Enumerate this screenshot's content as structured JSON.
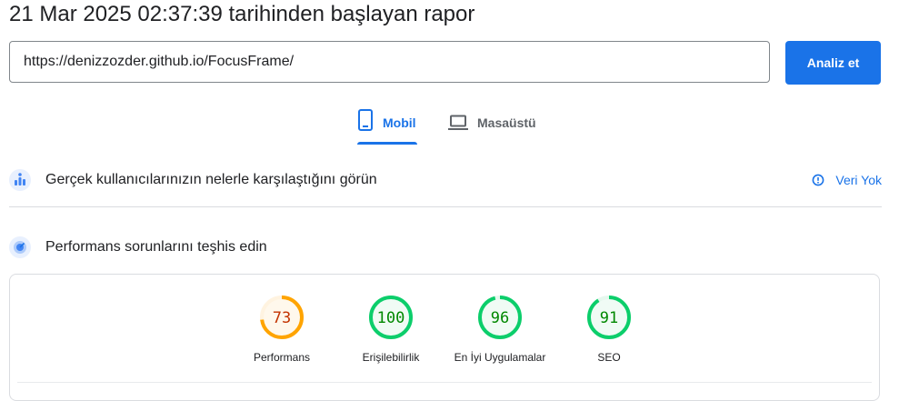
{
  "header": {
    "title": "21 Mar 2025 02:37:39 tarihinden başlayan rapor"
  },
  "search": {
    "value": "https://denizzozder.github.io/FocusFrame/",
    "button_label": "Analiz et"
  },
  "tabs": [
    {
      "label": "Mobil",
      "icon": "smartphone-icon",
      "active": true
    },
    {
      "label": "Masaüstü",
      "icon": "desktop-icon",
      "active": false
    }
  ],
  "field_data": {
    "title": "Gerçek kullanıcılarınızın nelerle karşılaştığını görün",
    "status_label": "Veri Yok",
    "icon": "users-chart-icon",
    "status_icon": "info-icon"
  },
  "lab_data": {
    "title": "Performans sorunlarını teşhis edin",
    "icon": "diagnose-icon"
  },
  "scores": [
    {
      "value": 73,
      "label": "Performans",
      "color": "#ffa400",
      "bg": "#fff3e0",
      "text_color": "#c33300"
    },
    {
      "value": 100,
      "label": "Erişilebilirlik",
      "color": "#0cce6b",
      "bg": "#e6f8ee",
      "text_color": "#008800"
    },
    {
      "value": 96,
      "label": "En İyi Uygulamalar",
      "color": "#0cce6b",
      "bg": "#e6f8ee",
      "text_color": "#008800"
    },
    {
      "value": 91,
      "label": "SEO",
      "color": "#0cce6b",
      "bg": "#e6f8ee",
      "text_color": "#008800"
    }
  ],
  "colors": {
    "accent": "#1a73e8",
    "average": "#ffa400",
    "pass": "#0cce6b"
  }
}
